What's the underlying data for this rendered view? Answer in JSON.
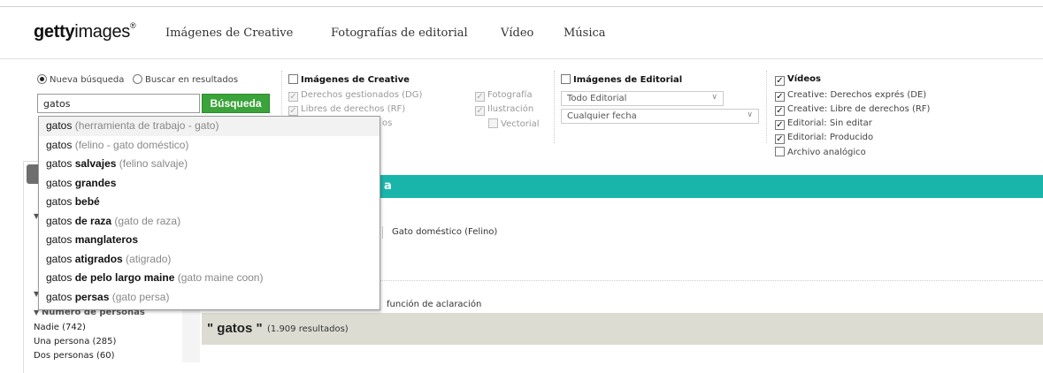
{
  "header": {
    "logo_bold": "getty",
    "logo_rest": "images",
    "logo_reg": "®",
    "nav": [
      "Imágenes de Creative",
      "Fotografías de editorial",
      "Vídeo",
      "Música"
    ]
  },
  "search": {
    "radio_new": "Nueva búsqueda",
    "radio_within": "Buscar en resultados",
    "query": "gatos",
    "button": "Búsqueda"
  },
  "creative": {
    "title": "Imágenes de Creative",
    "rights": [
      "Derechos gestionados (DG)",
      "Libres de derechos (RF)"
    ],
    "types": [
      "Fotografía",
      "Ilustración",
      "Vectorial"
    ],
    "partial": "os"
  },
  "editorial": {
    "title": "Imágenes de Editorial",
    "select1": "Todo Editorial",
    "select2": "Cualquier fecha"
  },
  "videos": {
    "title": "Vídeos",
    "items": [
      {
        "label": "Creative: Derechos exprés (DE)",
        "checked": true
      },
      {
        "label": "Creative: Libre de derechos (RF)",
        "checked": true
      },
      {
        "label": "Editorial: Sin editar",
        "checked": true
      },
      {
        "label": "Editorial: Producido",
        "checked": true
      },
      {
        "label": "Archivo analógico",
        "checked": false
      }
    ]
  },
  "suggestions": [
    {
      "pre": "gatos ",
      "bold": "",
      "gray": "(herramienta de trabajo - gato)"
    },
    {
      "pre": "gatos ",
      "bold": "",
      "gray": "(felino - gato doméstico)"
    },
    {
      "pre": "gatos ",
      "bold": "salvajes",
      "gray": " (felino salvaje)"
    },
    {
      "pre": "gatos ",
      "bold": "grandes",
      "gray": ""
    },
    {
      "pre": "gatos ",
      "bold": "bebé",
      "gray": ""
    },
    {
      "pre": "gatos ",
      "bold": "de raza",
      "gray": " (gato de raza)"
    },
    {
      "pre": "gatos ",
      "bold": "manglateros",
      "gray": ""
    },
    {
      "pre": "gatos ",
      "bold": "atigrados",
      "gray": " (atigrado)"
    },
    {
      "pre": "gatos ",
      "bold": "de pelo largo maine",
      "gray": " (gato maine coon)"
    },
    {
      "pre": "gatos ",
      "bold": "persas",
      "gray": " (gato persa)"
    }
  ],
  "teal_bar_text": "a",
  "disambiguation": {
    "option": "Gato doméstico (Felino)",
    "function_text": "función de aclaración"
  },
  "left_panel": {
    "section": "Número de personas",
    "items": [
      "Nadie (742)",
      "Una persona (285)",
      "Dos personas (60)"
    ]
  },
  "results": {
    "query": "\" gatos \"",
    "count": "(1.909 resultados)"
  }
}
